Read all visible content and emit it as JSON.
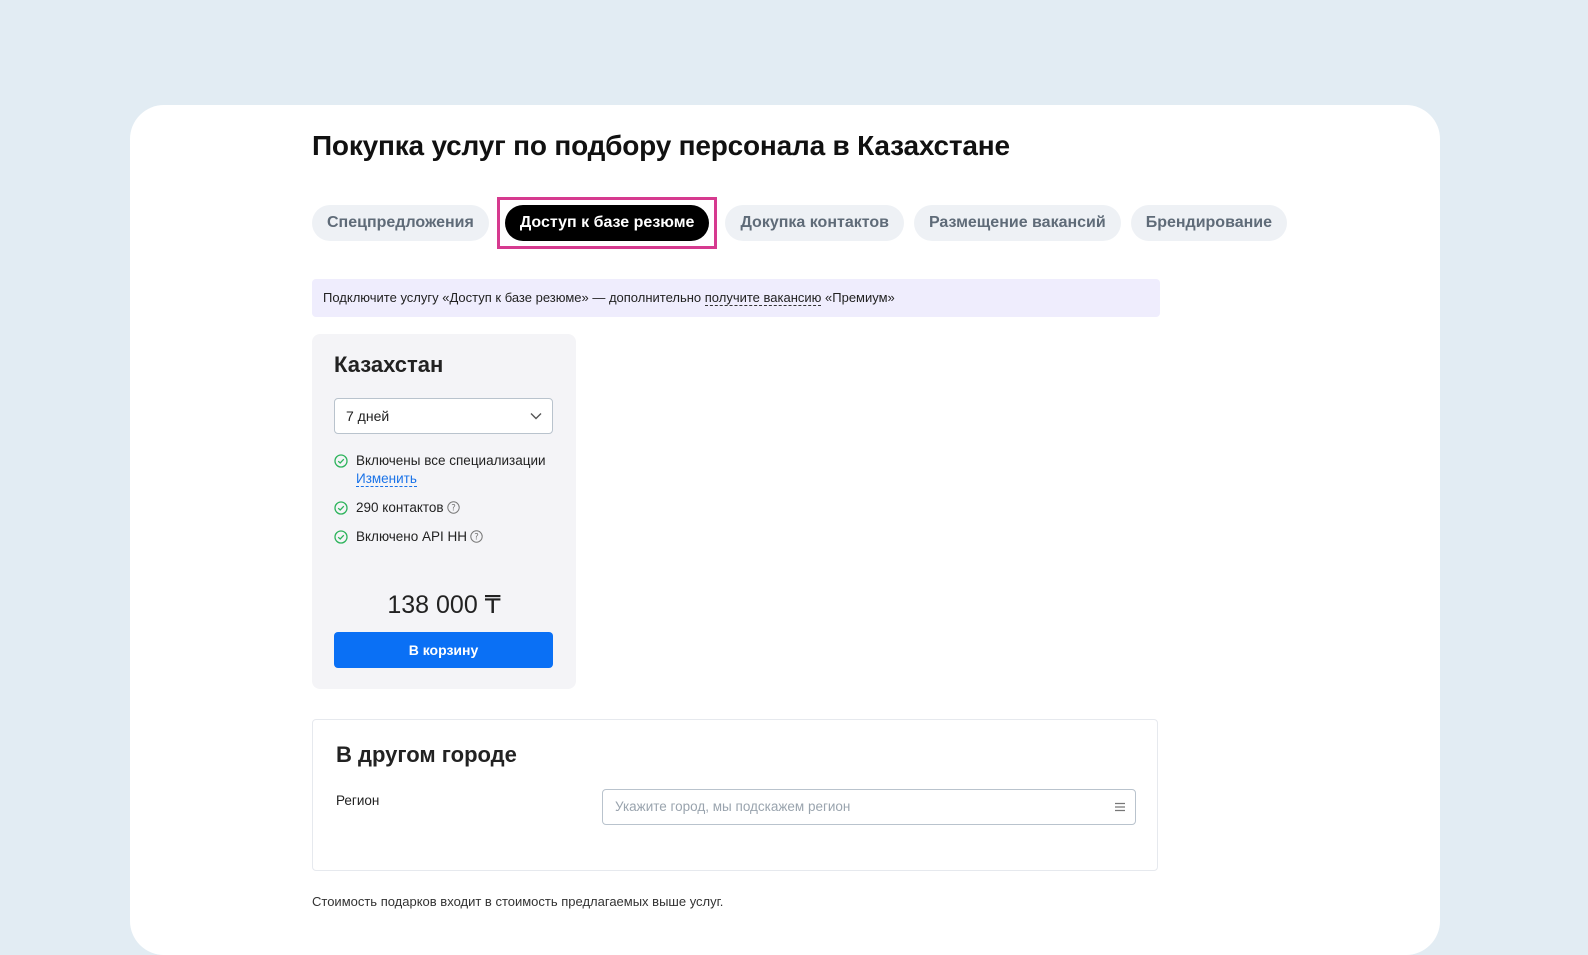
{
  "page": {
    "title": "Покупка услуг по подбору персонала в Казахстане"
  },
  "tabs": [
    {
      "label": "Спецпредложения",
      "active": false
    },
    {
      "label": "Доступ к базе резюме",
      "active": true
    },
    {
      "label": "Докупка контактов",
      "active": false
    },
    {
      "label": "Размещение вакансий",
      "active": false
    },
    {
      "label": "Брендирование",
      "active": false
    }
  ],
  "banner": {
    "text_before": "Подключите услугу «Доступ к базе резюме» — дополнительно ",
    "link": "получите вакансию",
    "text_after": " «Премиум»"
  },
  "offer": {
    "title": "Казахстан",
    "period_selected": "7 дней",
    "features": [
      {
        "text": "Включены все специализации",
        "link": "Изменить"
      },
      {
        "text": "290 контактов",
        "help": true
      },
      {
        "text": "Включено API HH",
        "help": true
      }
    ],
    "price": "138 000 ₸",
    "cart_button": "В корзину"
  },
  "other_city": {
    "title": "В другом городе",
    "region_label": "Регион",
    "region_placeholder": "Укажите город, мы подскажем регион"
  },
  "footnote": "Стоимость подарков входит в стоимость предлагаемых выше услуг.",
  "colors": {
    "background": "#e2ecf3",
    "accent_blue": "#0a70f5",
    "check_green": "#2cb35b",
    "highlight_border": "#d63a8f",
    "banner_bg": "#efedfd"
  }
}
